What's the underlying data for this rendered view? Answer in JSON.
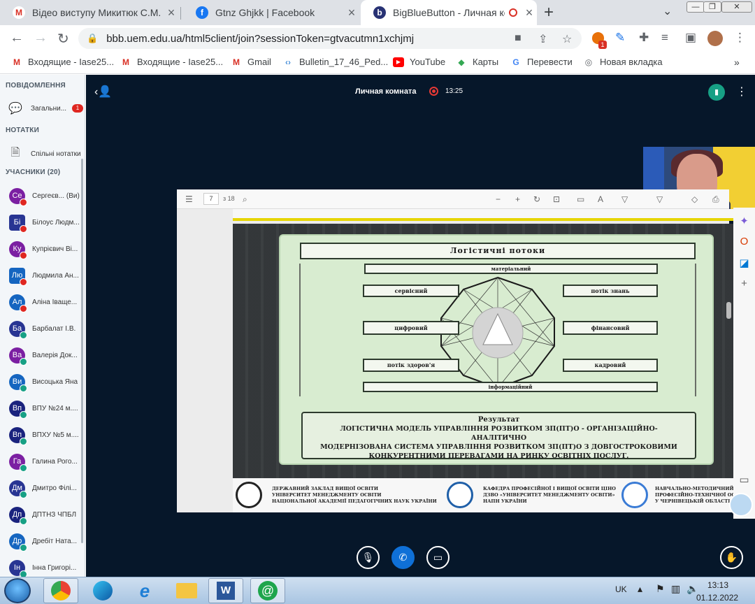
{
  "browser": {
    "tabs": [
      {
        "favicon": "M",
        "favicon_color": "#d93025",
        "title": "Відео виступу Микитюк С.М. на"
      },
      {
        "favicon": "f",
        "favicon_color": "#1877f2",
        "title": "Gtnz Ghjkk | Facebook"
      },
      {
        "favicon": "b",
        "favicon_color": "#283274",
        "title": "BigBlueButton - Личная ком"
      }
    ],
    "url": "bbb.uem.edu.ua/html5client/join?sessionToken=gtvacutmn1xchjmj",
    "extension_badge": "1"
  },
  "bookmarks": [
    {
      "icon": "M",
      "color": "#d93025",
      "label": "Входящие - Iase25..."
    },
    {
      "icon": "M",
      "color": "#d93025",
      "label": "Входящие - Iase25..."
    },
    {
      "icon": "M",
      "color": "#d93025",
      "label": "Gmail"
    },
    {
      "icon": "‹›",
      "color": "#4a90d9",
      "label": "Bulletin_17_46_Ped..."
    },
    {
      "icon": "▶",
      "color": "#ff0000",
      "label": "YouTube"
    },
    {
      "icon": "◆",
      "color": "#34a853",
      "label": "Карты"
    },
    {
      "icon": "G",
      "color": "#4285f4",
      "label": "Перевести"
    },
    {
      "icon": "◎",
      "color": "#5f6368",
      "label": "Новая вкладка"
    }
  ],
  "bookmarks_more": "»",
  "sidebar": {
    "messages_header": "ПОВІДОМЛЕННЯ",
    "chat_label": "Загальни...",
    "chat_badge": "1",
    "notes_header": "НОТАТКИ",
    "notes_label": "Спільні нотатки",
    "users_header": "УЧАСНИКИ (20)",
    "users": [
      {
        "initials": "Се",
        "name": "Сергеєв... (Ви)",
        "color": "#7b1fa2",
        "status": "#df2721",
        "shape": "circle"
      },
      {
        "initials": "Бі",
        "name": "Білоус Людм...",
        "color": "#283593",
        "status": "#df2721",
        "shape": "square"
      },
      {
        "initials": "Ку",
        "name": "Купрієвич Ві...",
        "color": "#7b1fa2",
        "status": "#df2721",
        "shape": "circle"
      },
      {
        "initials": "Лю",
        "name": "Людмила Ан...",
        "color": "#1565c0",
        "status": "#df2721",
        "shape": "square"
      },
      {
        "initials": "Ал",
        "name": "Аліна Іваще...",
        "color": "#1565c0",
        "status": "#df2721",
        "shape": "circle"
      },
      {
        "initials": "Ба",
        "name": "Барбалат І.В.",
        "color": "#283593",
        "status": "#17a085",
        "shape": "circle"
      },
      {
        "initials": "Ва",
        "name": "Валерія Док...",
        "color": "#7b1fa2",
        "status": "#17a085",
        "shape": "circle"
      },
      {
        "initials": "Ви",
        "name": "Висоцька Яна",
        "color": "#1565c0",
        "status": "#17a085",
        "shape": "circle"
      },
      {
        "initials": "Вп",
        "name": "ВПУ №24 м....",
        "color": "#1a237e",
        "status": "#17a085",
        "shape": "circle"
      },
      {
        "initials": "Вп",
        "name": "ВПХУ №5 м....",
        "color": "#1a237e",
        "status": "#17a085",
        "shape": "circle"
      },
      {
        "initials": "Га",
        "name": "Галина Рого...",
        "color": "#7b1fa2",
        "status": "#17a085",
        "shape": "circle"
      },
      {
        "initials": "Дм",
        "name": "Дмитро Філі...",
        "color": "#283593",
        "status": "#17a085",
        "shape": "circle"
      },
      {
        "initials": "Дп",
        "name": "ДПТНЗ ЧПБЛ",
        "color": "#1a237e",
        "status": "#17a085",
        "shape": "circle"
      },
      {
        "initials": "Др",
        "name": "Дребіт Ната...",
        "color": "#1565c0",
        "status": "#17a085",
        "shape": "circle"
      },
      {
        "initials": "Ін",
        "name": "Інна Григорі...",
        "color": "#283593",
        "status": "#17a085",
        "shape": "circle"
      }
    ]
  },
  "meeting": {
    "title": "Личная комната",
    "record_time": "13:25"
  },
  "presentation": {
    "page": "7",
    "total": "з 18",
    "slide_title": "Логістичні потоки",
    "flows": {
      "top": "матеріальний",
      "left1": "сервісний",
      "right1": "потік знань",
      "left2": "цифровий",
      "right2": "фінансовий",
      "left3": "потік здоров'я",
      "right3": "кадровий",
      "bottom": "інформаційний"
    },
    "result_title": "Результат",
    "result_lines": [
      "ЛОГІСТИЧНА МОДЕЛЬ УПРАВЛІННЯ РОЗВИТКОМ ЗП(ПТ)О - ОРГАНІЗАЦІЙНО-АНАЛІТИЧНО",
      "МОДЕРНІЗОВАНА СИСТЕМА УПРАВЛІННЯ РОЗВИТКОМ ЗП(ПТ)О З ДОВГОСТРОКОВИМИ",
      "КОНКУРЕНТНИМИ ПЕРЕВАГАМИ НА РИНКУ ОСВІТНІХ ПОСЛУГ."
    ],
    "footer": [
      [
        "ДЕРЖАВНИЙ ЗАКЛАД ВИЩОЇ ОСВІТИ",
        "УНІВЕРСИТЕТ МЕНЕДЖМЕНТУ ОСВІТИ",
        "НАЦІОНАЛЬНОЇ АКАДЕМІЇ ПЕДАГОГІЧНИХ НАУК УКРАЇНИ"
      ],
      [
        "КАФЕДРА ПРОФЕСІЙНОЇ І ВИЩОЇ ОСВІТИ ЦІНО",
        "ДЗВО «УНІВЕРСИТЕТ МЕНЕДЖМЕНТУ ОСВІТИ»",
        "НАПН УКРАЇНИ"
      ],
      [
        "НАВЧАЛЬНО-МЕТОДИЧНИЙ ЦЕНТР",
        "ПРОФЕСІЙНО-ТЕХНІЧНОЇ ОСВІТИ",
        "У ЧЕРНІВЕЦЬКІЙ ОБЛАСТІ"
      ]
    ]
  },
  "taskbar": {
    "lang": "UK",
    "time": "13:13",
    "date": "01.12.2022"
  }
}
